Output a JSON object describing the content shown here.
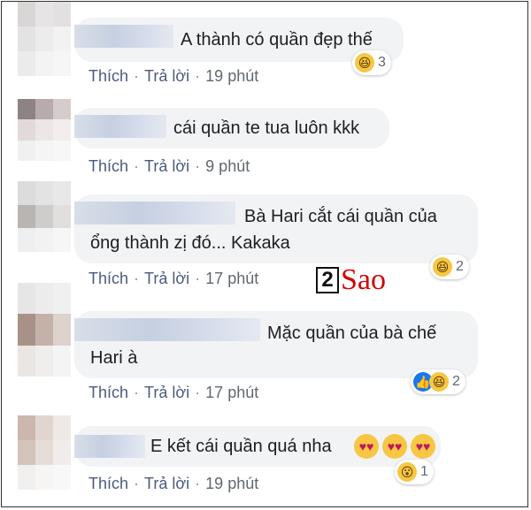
{
  "comments": [
    {
      "text_lines": [
        "A thành có quần đẹp thế"
      ],
      "like": "Thích",
      "reply": "Trả lời",
      "time": "19 phút",
      "reaction_count": "3"
    },
    {
      "text_lines": [
        "cái quần te tua luôn kkk"
      ],
      "like": "Thích",
      "reply": "Trả lời",
      "time": "9 phút",
      "reaction_count": ""
    },
    {
      "text_lines": [
        "Bà Hari cắt cái quần của",
        "ổng thành zị đó... Kakaka"
      ],
      "like": "Thích",
      "reply": "Trả lời",
      "time": "17 phút",
      "reaction_count": "2"
    },
    {
      "text_lines": [
        "Mặc quần của bà chế",
        "Hari à"
      ],
      "like": "Thích",
      "reply": "Trả lời",
      "time": "17 phút",
      "reaction_count": "2"
    },
    {
      "text_lines": [
        "E kết cái quần quá nha"
      ],
      "like": "Thích",
      "reply": "Trả lời",
      "time": "19 phút",
      "reaction_count": "1"
    }
  ],
  "separator": "·",
  "watermark": {
    "number": "2",
    "text": "Sao"
  },
  "icons": {
    "haha": "laughing-emoji-icon",
    "like": "like-thumb-icon",
    "wow": "wow-emoji-icon",
    "hearteyes": "heart-eyes-emoji-icon"
  },
  "colors": {
    "bubble": "#f2f3f5",
    "link": "#4b5a80",
    "text": "#1c1e21",
    "watermark": "#d40000"
  }
}
